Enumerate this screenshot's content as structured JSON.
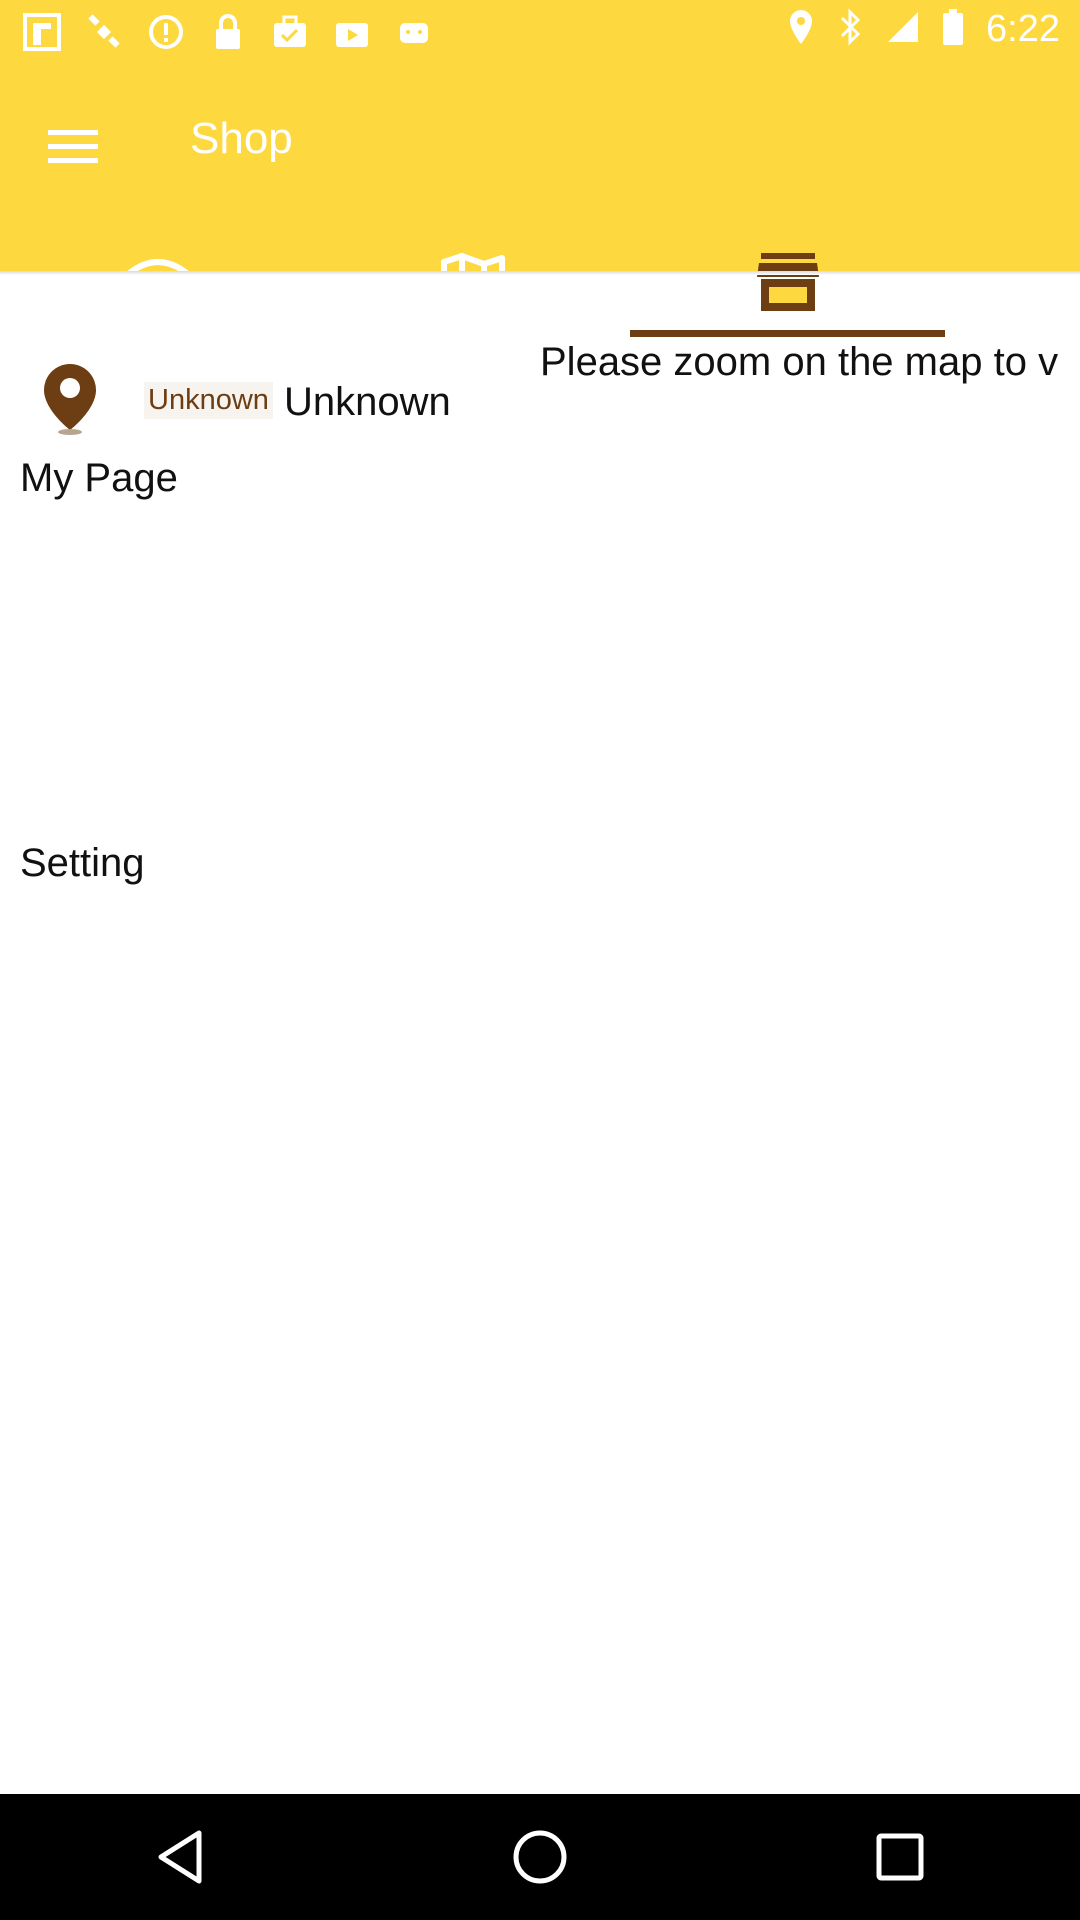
{
  "status_bar": {
    "time": "6:22",
    "left_icons": [
      "fake-app-icon",
      "satellite-icon",
      "info-icon",
      "lock-icon",
      "briefcase-check-icon",
      "play-bag-icon",
      "android-icon"
    ],
    "right_icons": [
      "location-icon",
      "bluetooth-icon",
      "signal-icon",
      "battery-icon"
    ]
  },
  "app_bar": {
    "title": "Shop",
    "menu_icon": "hamburger-menu-icon",
    "background_color": "#fdd83f"
  },
  "tabs": [
    {
      "icon": "wifi-icon",
      "active": false
    },
    {
      "icon": "map-icon",
      "active": false
    },
    {
      "icon": "store-icon",
      "active": true
    }
  ],
  "colors": {
    "accent": "#6d3d14",
    "brand_yellow": "#fdd83f"
  },
  "location": {
    "pin_icon": "map-pin-icon",
    "label_small": "Unknown",
    "label_big": "Unknown"
  },
  "notice": "Please zoom on the map to v",
  "menu": {
    "my_page": "My Page",
    "setting": "Setting"
  },
  "nav_bar": [
    "back-icon",
    "home-icon",
    "recents-icon"
  ]
}
